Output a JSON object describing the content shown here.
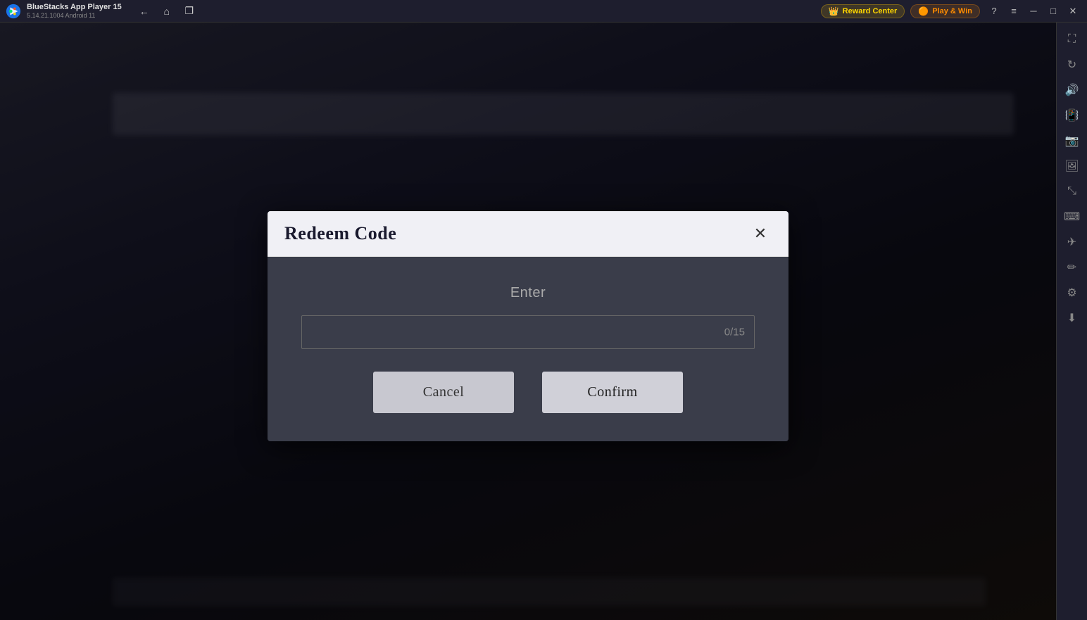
{
  "titlebar": {
    "app_name": "BlueStacks App Player 15",
    "app_version": "5.14.21.1004  Android 11",
    "reward_center_label": "Reward Center",
    "play_and_win_label": "Play & Win",
    "nav_back_icon": "←",
    "nav_home_icon": "⌂",
    "nav_copy_icon": "❐",
    "help_icon": "?",
    "menu_icon": "≡",
    "minimize_icon": "─",
    "maximize_icon": "□",
    "close_icon": "✕",
    "fullscreen_icon": "⛶",
    "fullscreen2_icon": "⛶"
  },
  "modal": {
    "title": "Redeem Code",
    "close_icon": "✕",
    "enter_label": "Enter",
    "input_placeholder": "",
    "input_counter": "0/15",
    "cancel_label": "Cancel",
    "confirm_label": "Confirm"
  },
  "sidebar": {
    "icons": [
      {
        "name": "fullscreen-icon",
        "symbol": "⛶"
      },
      {
        "name": "rotate-icon",
        "symbol": "↻"
      },
      {
        "name": "volume-icon",
        "symbol": "🔊"
      },
      {
        "name": "shake-icon",
        "symbol": "📳"
      },
      {
        "name": "camera-icon",
        "symbol": "📷"
      },
      {
        "name": "screenshot-icon",
        "symbol": "🖼"
      },
      {
        "name": "resize-icon",
        "symbol": "⤡"
      },
      {
        "name": "keyboard-icon",
        "symbol": "⌨"
      },
      {
        "name": "plane-icon",
        "symbol": "✈"
      },
      {
        "name": "edit-icon",
        "symbol": "✏"
      },
      {
        "name": "settings-icon",
        "symbol": "⚙"
      },
      {
        "name": "download-icon",
        "symbol": "⬇"
      }
    ]
  }
}
